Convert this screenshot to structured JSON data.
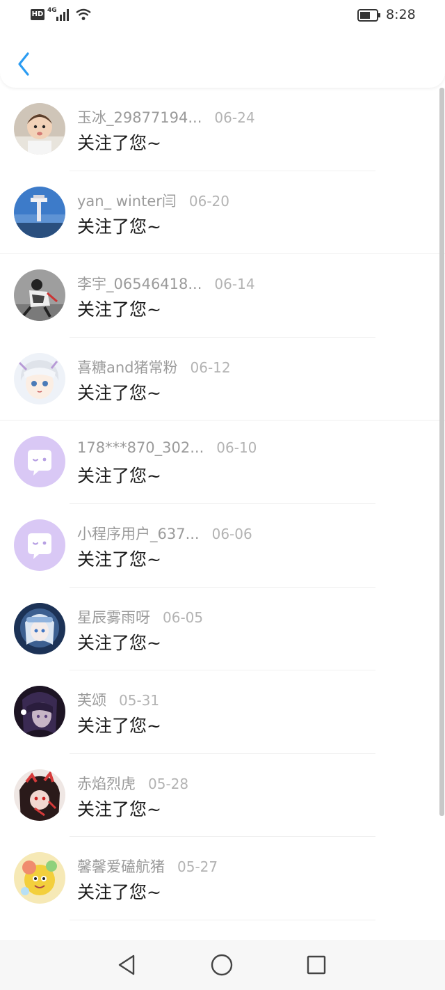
{
  "status_bar": {
    "hd": "HD",
    "network": "4G",
    "time": "8:28"
  },
  "message_text": "关注了您~",
  "items": [
    {
      "name": "玉冰_29877194...",
      "date": "06-24",
      "avatar": "baby-photo"
    },
    {
      "name": "yan_ winter闫",
      "date": "06-20",
      "avatar": "tower-photo"
    },
    {
      "name": "李宇_06546418...",
      "date": "06-14",
      "avatar": "skater-photo"
    },
    {
      "name": "喜糖and猪常粉",
      "date": "06-12",
      "avatar": "anime-photo"
    },
    {
      "name": "178***870_302...",
      "date": "06-10",
      "avatar": "default-chat"
    },
    {
      "name": "小程序用户_637...",
      "date": "06-06",
      "avatar": "default-chat"
    },
    {
      "name": "星辰雾雨呀",
      "date": "06-05",
      "avatar": "anime-blue"
    },
    {
      "name": "芙颂",
      "date": "05-31",
      "avatar": "anime-dark"
    },
    {
      "name": "赤焰烈虎",
      "date": "05-28",
      "avatar": "anime-red"
    },
    {
      "name": "馨馨爱磕航猪",
      "date": "05-27",
      "avatar": "cartoon-yellow"
    }
  ],
  "colors": {
    "accent": "#2b9cf2",
    "default_avatar": "#d9c8f5",
    "default_avatar_icon": "#ffffff"
  }
}
